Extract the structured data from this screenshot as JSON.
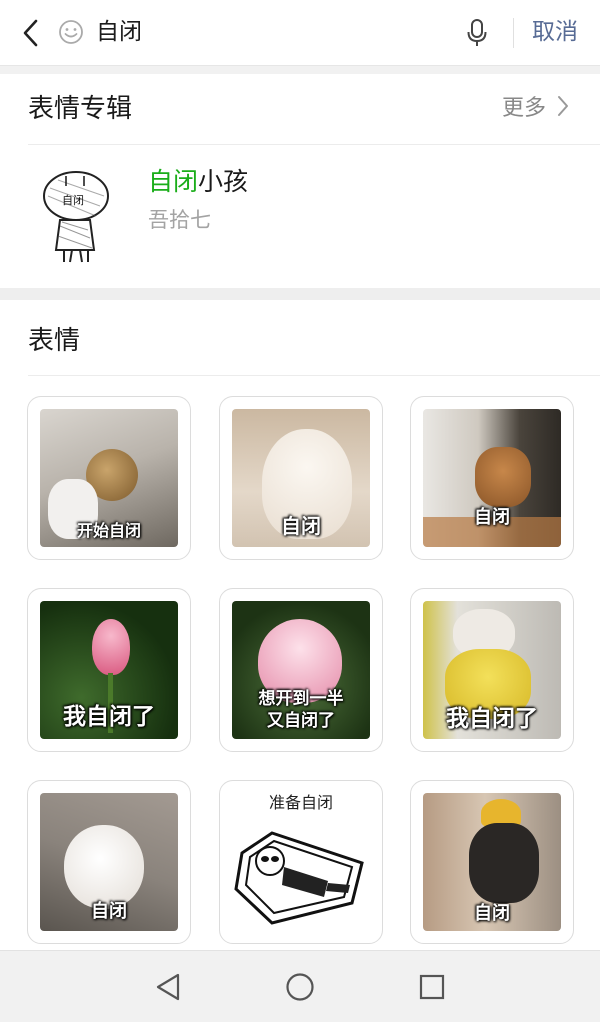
{
  "search": {
    "query": "自闭",
    "cancel_label": "取消"
  },
  "album_section": {
    "title": "表情专辑",
    "more_label": "更多",
    "item": {
      "name_highlight": "自闭",
      "name_rest": "小孩",
      "author": "吾拾七",
      "thumb_text": "自闭"
    }
  },
  "stickers_section": {
    "title": "表情",
    "stickers": [
      {
        "caption": "开始自闭"
      },
      {
        "caption": "自闭"
      },
      {
        "caption": "自闭"
      },
      {
        "caption": "我自闭了"
      },
      {
        "caption": "想开到一半",
        "caption2": "又自闭了"
      },
      {
        "caption": "我自闭了"
      },
      {
        "caption": "自闭"
      },
      {
        "caption": "准备自闭"
      },
      {
        "caption": "自闭"
      }
    ]
  },
  "icons": {
    "back": "chevron-left-icon",
    "emoji": "smiley-icon",
    "mic": "microphone-icon",
    "more_arrow": "chevron-right-icon",
    "nav_back": "triangle-back-icon",
    "nav_home": "circle-home-icon",
    "nav_recent": "square-recent-icon"
  },
  "colors": {
    "highlight": "#1aad19",
    "link": "#576b95",
    "muted": "#a3a3a3"
  }
}
